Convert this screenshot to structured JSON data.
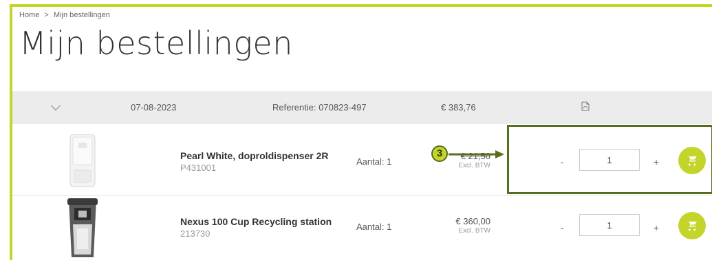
{
  "breadcrumb": {
    "home": "Home",
    "separator": ">",
    "current": "Mijn bestellingen"
  },
  "page": {
    "title": "Mijn bestellingen"
  },
  "order": {
    "date": "07-08-2023",
    "reference": "Referentie: 070823-497",
    "total": "€ 383,76"
  },
  "items": [
    {
      "name": "Pearl White, doproldispenser 2R",
      "sku": "P431001",
      "quantity_label": "Aantal: 1",
      "price": "€ 21,50",
      "excl": "Excl. BTW",
      "qty_value": "1",
      "minus": "-",
      "plus": "+"
    },
    {
      "name": "Nexus 100 Cup Recycling station",
      "sku": "213730",
      "quantity_label": "Aantal: 1",
      "price": "€ 360,00",
      "excl": "Excl. BTW",
      "qty_value": "1",
      "minus": "-",
      "plus": "+"
    }
  ],
  "annotation": {
    "step": "3"
  },
  "colors": {
    "accent": "#c3d52b",
    "highlight": "#556f1c",
    "header_bg": "#ececec"
  }
}
